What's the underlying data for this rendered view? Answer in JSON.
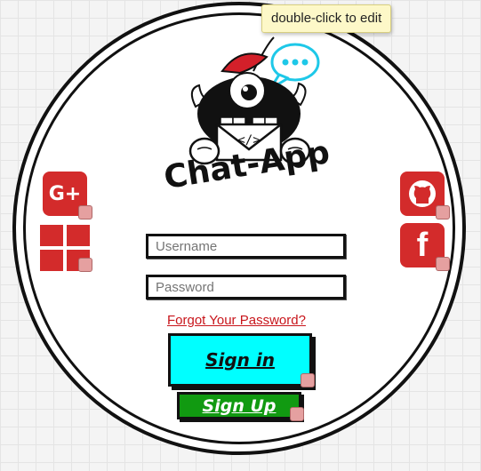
{
  "tooltip": {
    "text": "double-click to edit"
  },
  "app": {
    "title": "Chat-App"
  },
  "form": {
    "username_placeholder": "Username",
    "password_placeholder": "Password",
    "forgot_label": "Forgot Your Password?",
    "signin_label": "Sign in",
    "signup_label": "Sign Up"
  },
  "social": {
    "google_label": "G+",
    "facebook_label": "f"
  },
  "colors": {
    "signin_bg": "#00ffff",
    "signup_bg": "#119a11",
    "social_red": "#d32b2b",
    "link_red": "#c8151b"
  }
}
